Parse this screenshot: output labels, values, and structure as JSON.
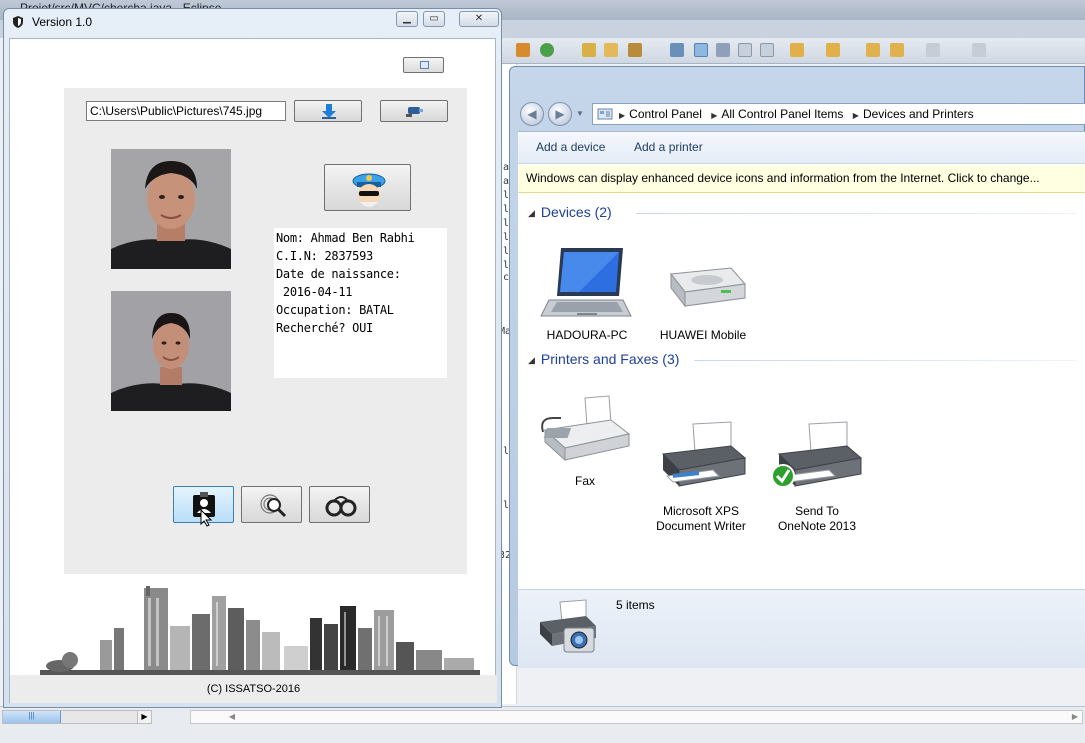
{
  "background": {
    "eclipse_title": "Projet/src/MVC/chercha.java - Eclipse",
    "code_letters": [
      "al",
      "al",
      "l",
      "l",
      "l",
      "l",
      "l",
      "l",
      "c",
      "Ma",
      "l",
      "l",
      "32"
    ]
  },
  "app": {
    "title": "Version 1.0",
    "path_value": "C:\\Users\\Public\\Pictures\\745.jpg",
    "info": {
      "nom": "Nom: Ahmad Ben Rabhi",
      "cin": "C.I.N: 2837593",
      "dob_label": "Date de naissance:",
      "dob_value": " 2016-04-11",
      "occupation": "Occupation: BATAL",
      "recherche": "Recherché? OUI"
    },
    "footer": "(C) ISSATSO-2016"
  },
  "control_panel": {
    "breadcrumbs": [
      "Control Panel",
      "All Control Panel Items",
      "Devices and Printers"
    ],
    "commands": [
      "Add a device",
      "Add a printer"
    ],
    "info_bar": "Windows can display enhanced device icons and information from the Internet. Click to change...",
    "groups": [
      {
        "title": "Devices (2)",
        "items": [
          {
            "name": "HADOURA-PC",
            "icon": "laptop-icon"
          },
          {
            "name": "HUAWEI Mobile",
            "icon": "drive-icon"
          }
        ]
      },
      {
        "title": "Printers and Faxes (3)",
        "items": [
          {
            "name": "Fax",
            "icon": "fax-icon"
          },
          {
            "name": "Microsoft XPS\nDocument Writer",
            "icon": "printer-icon"
          },
          {
            "name": "Send To\nOneNote 2013",
            "icon": "printer-default-icon"
          }
        ]
      }
    ],
    "status": "5 items"
  },
  "colors": {
    "group_head": "#1e3f9b",
    "info_bar_bg": "#ffffe1",
    "check_green": "#2ea02e"
  }
}
